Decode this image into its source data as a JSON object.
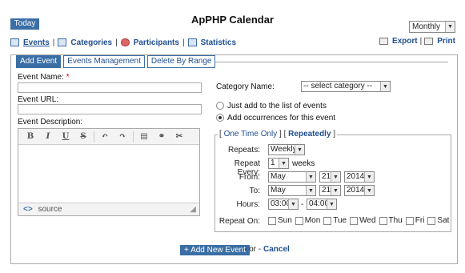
{
  "header": {
    "today_button": "Today",
    "title": "ApPHP Calendar",
    "view_select": "Monthly"
  },
  "nav": {
    "events": "Events",
    "categories": "Categories",
    "participants": "Participants",
    "statistics": "Statistics",
    "export": "Export",
    "print": "Print"
  },
  "tabs": [
    "Add Event",
    "Events Management",
    "Delete By Range"
  ],
  "form": {
    "event_name_label": "Event Name:",
    "required_mark": "*",
    "event_url_label": "Event URL:",
    "event_description_label": "Event Description:",
    "editor_tools": [
      "B",
      "I",
      "U",
      "S",
      "↶",
      "↷",
      "▤",
      "⚭",
      "✂"
    ],
    "source_label": "source",
    "source_icon": "<>",
    "category_label": "Category Name:",
    "category_select": "-- select category --",
    "radio_list": "Just add to the list of events",
    "radio_occurrences": "Add occurrences for this event"
  },
  "repeat": {
    "one_time": "One Time Only",
    "repeatedly": "Repeatedly",
    "repeats_label": "Repeats:",
    "repeats_value": "Weekly",
    "every_label": "Repeat Every:",
    "every_value": "1",
    "every_unit": "weeks",
    "from_label": "From:",
    "from_month": "May",
    "from_day": "21",
    "from_year": "2014",
    "to_label": "To:",
    "to_month": "May",
    "to_day": "21",
    "to_year": "2014",
    "hours_label": "Hours:",
    "hours_from": "03:00",
    "hours_sep": "-",
    "hours_to": "04:00",
    "repeat_on_label": "Repeat On:",
    "days": [
      "Sun",
      "Mon",
      "Tue",
      "Wed",
      "Thu",
      "Fri",
      "Sat"
    ]
  },
  "actions": {
    "add_button": "+ Add New Event",
    "or_text": "- or -",
    "cancel": "Cancel"
  },
  "colors": {
    "accent": "#3a6ea5",
    "link": "#1f4e91"
  }
}
